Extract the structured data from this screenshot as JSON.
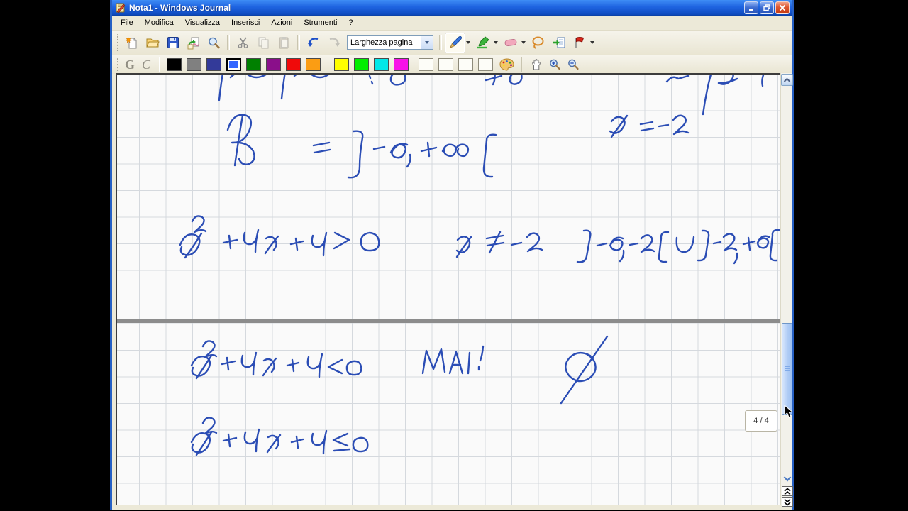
{
  "window": {
    "title": "Nota1 - Windows Journal",
    "titlebar_color": "#1e63e0",
    "border_color": "#2660c4"
  },
  "menu_bar": {
    "items": [
      {
        "label": "File",
        "name": "file"
      },
      {
        "label": "Modifica",
        "name": "modifica"
      },
      {
        "label": "Visualizza",
        "name": "visualizza"
      },
      {
        "label": "Inserisci",
        "name": "inserisci"
      },
      {
        "label": "Azioni",
        "name": "azioni"
      },
      {
        "label": "Strumenti",
        "name": "strumenti"
      },
      {
        "label": "?",
        "name": "help"
      }
    ]
  },
  "toolbar_main": {
    "page_width_value": "Larghezza pagina",
    "buttons": [
      "new-note",
      "open",
      "save",
      "import-picture",
      "search",
      "cut",
      "copy",
      "paste",
      "undo",
      "redo",
      "pen",
      "highlighter",
      "eraser",
      "lasso",
      "insert-note",
      "flag"
    ],
    "disabled_buttons": [
      "copy",
      "paste",
      "redo"
    ],
    "selected_tool": "pen"
  },
  "toolbar_format": {
    "bold_label": "G",
    "italic_label": "C",
    "selected_index": 3,
    "colors": [
      {
        "name": "black",
        "hex": "#000000"
      },
      {
        "name": "gray",
        "hex": "#808080"
      },
      {
        "name": "navy",
        "hex": "#333a99"
      },
      {
        "name": "blue",
        "hex": "#3366ff"
      },
      {
        "name": "green",
        "hex": "#008000"
      },
      {
        "name": "purple",
        "hex": "#8a0f8a"
      },
      {
        "name": "red",
        "hex": "#f00a0a"
      },
      {
        "name": "orange",
        "hex": "#fb9d13"
      },
      {
        "name": "yellow",
        "hex": "#ffff00"
      },
      {
        "name": "lime",
        "hex": "#00ee00"
      },
      {
        "name": "cyan",
        "hex": "#00e8e8"
      },
      {
        "name": "magenta",
        "hex": "#f812e8"
      }
    ],
    "thickness_slots": 4
  },
  "icons": {
    "new-note": "page with orange star",
    "open": "open folder",
    "save": "blue floppy disk",
    "import-picture": "pages with green arrow",
    "search": "magnifier",
    "cut": "scissors",
    "copy": "two pages",
    "paste": "clipboard",
    "undo": "curved arrow left",
    "redo": "curved arrow right",
    "pen": "blue pen",
    "highlighter": "green marker",
    "eraser": "pink eraser",
    "lasso": "lasso loop",
    "insert-note": "page with green arrow",
    "flag": "red flag",
    "palette": "paint palette",
    "pan-hand": "open hand",
    "zoom-in": "magnifier plus",
    "zoom-out": "magnifier minus",
    "minimize": "underscore",
    "restore": "overlapping squares",
    "close": "x",
    "scroll-up": "chevron up",
    "scroll-down": "chevron down",
    "prev-page": "double chevron up",
    "next-page": "double chevron down"
  },
  "nav": {
    "page_indicator": "4 / 4"
  },
  "ink": {
    "color": "#2b4db5",
    "lines": [
      {
        "name": "top-clipped-line",
        "text": "(riga di scrittura tagliata in alto)",
        "strokes": [
          "M150,-8 Q146,16 144,36",
          "M160,4 Q172,-8 184,0 Q196,8 210,0",
          "M238,-10 Q234,14 232,34",
          "M250,2 Q262,-8 274,0 Q286,8 298,0",
          "M356,2 L357,5",
          "M359,10 L360,13",
          "M395,-4 Q385,0 386,8 Q388,16 398,14 Q408,12 406,2 Q404,-4 396,-4",
          "M520,8 L542,2",
          "M532,-6 Q534,6 530,14",
          "M560,-2 Q552,2 554,10 Q558,16 566,12 Q572,8 570,0",
          "M775,10 Q783,0 791,6 L805,2",
          "M838,-4 Q830,26 826,56",
          "M846,-2 Q856,-10 866,-4 Q872,2 864,10 Q856,16 848,12 Q862,12 874,6",
          "M912,-2 Q908,8 910,16"
        ]
      },
      {
        "name": "x-equals-minus-2",
        "text": "x = -2",
        "strokes": [
          "M697,66 Q705,56 713,62 Q719,68 711,78 Q703,86 695,80",
          "M719,58 Q707,74 697,88",
          "M738,70 L755,67",
          "M739,79 L756,76",
          "M764,73 L777,71",
          "M784,64 Q792,54 800,60 Q805,66 796,74 L785,84 Q796,77 805,82"
        ]
      },
      {
        "name": "reals-interval",
        "text": "R = ]-oo, +oo[",
        "strokes": [
          "M166,128 Q171,92 177,58",
          "M156,78 Q163,54 180,57 Q194,61 186,80 Q178,97 162,96 Q184,94 192,108 Q197,121 186,126 Q176,129 172,119",
          "M277,100 L299,96",
          "M278,110 L300,106",
          "M333,80 Q348,78 346,89 Q342,112 342,130 Q342,147 326,145",
          "M362,105 L377,102",
          "M386,110 Q391,97 401,99 Q410,101 405,111 Q400,120 391,116 Q384,111 391,104 Q399,94 409,99",
          "M413,113 Q415,122 409,130",
          "M429,108 L450,103",
          "M438,96 L440,115",
          "M459,108 Q463,97 472,99 Q480,101 477,109 Q474,117 466,114 Q459,111 462,104 M477,106 Q481,97 490,99 Q497,102 494,110 Q491,117 484,114 Q478,111 481,105",
          "M534,85 Q521,83 521,93 L517,132 Q516,145 529,144"
        ]
      },
      {
        "name": "inequality-gt",
        "text": "x^2 + 4x + 4 > 0",
        "strokes": [
          "M89,240 Q96,222 110,226 Q121,231 113,245 Q105,258 93,253 Q88,250 91,243",
          "M119,224 Q107,243 96,258",
          "M106,207 Q111,196 120,201 Q126,206 118,214 L109,222 Q120,217 125,221",
          "M150,237 L169,233",
          "M158,227 L160,245",
          "M180,223 Q176,237 185,239 Q193,240 197,230",
          "M199,219 Q195,235 195,250",
          "M210,231 Q218,226 223,233 Q227,240 221,247",
          "M227,228 Q217,240 209,252",
          "M245,239 L262,235",
          "M252,231 L254,247",
          "M276,227 Q272,241 281,243 Q289,244 293,234",
          "M295,223 Q291,240 291,255",
          "M307,223 L327,233 L306,245",
          "M356,223 Q343,225 344,237 Q345,249 358,248 Q371,247 369,234 Q367,224 356,223"
        ]
      },
      {
        "name": "x-not-equal",
        "text": "x =/= -2",
        "strokes": [
          "M480,233 Q488,225 495,231 Q500,238 493,247 Q486,254 479,248",
          "M499,229 Q488,243 479,257",
          "M521,231 L544,227",
          "M522,241 L545,237",
          "M540,222 L525,251",
          "M556,240 L570,237",
          "M578,229 Q586,220 593,226 Q598,232 590,240 L579,249 Q590,242 599,247"
        ]
      },
      {
        "name": "union-intervals",
        "text": "]-oo,-2[ U ]-2,+oo[",
        "strokes": [
          "M658,220 Q669,218 667,228 L662,256 Q660,266 649,264",
          "M677,241 L690,238",
          "M695,241 Q700,231 708,233 Q715,235 711,243 Q707,250 699,246 Q693,242 698,235 Q704,227 713,231",
          "M714,248 Q715,257 709,263",
          "M723,240 L734,238",
          "M739,231 Q747,223 753,229 Q757,234 749,242 L739,250 Q749,244 757,249",
          "M777,222 Q766,221 767,231 L764,256 Q763,265 774,264",
          "M789,230 Q787,250 799,250 Q811,250 813,229",
          "M825,220 Q835,219 834,228 L830,254 Q829,263 819,262",
          "M841,238 L851,236",
          "M855,229 Q863,221 869,227 Q873,232 865,240 L856,248 Q865,242 873,247",
          "M874,252 Q875,260 870,266",
          "M883,239 L899,235",
          "M890,230 L892,247",
          "M903,237 Q907,229 914,231 Q920,233 917,240 Q913,247 906,243 Q901,239 905,233 Q911,225 919,229",
          "M933,219 Q923,218 924,227 L921,254 Q920,263 930,262"
        ]
      },
      {
        "name": "inequality-lt",
        "text": "x^2 + 4x + 4 < 0",
        "strokes": [
          "M105,410 Q112,394 125,398 Q135,403 128,416 Q120,428 109,423 Q104,420 107,413",
          "M133,396 Q122,413 112,428",
          "M121,383 Q126,372 135,377 Q141,382 133,390 L124,398 Q135,393 140,397",
          "M148,408 L166,404",
          "M155,399 L157,416",
          "M177,396 Q173,410 182,412 Q190,413 194,403",
          "M196,392 Q192,408 192,423",
          "M207,403 Q215,398 220,405 Q224,412 218,419",
          "M224,400 Q214,412 206,424",
          "M240,410 L256,406",
          "M247,402 L249,418",
          "M270,398 Q266,412 275,414 Q283,415 287,405",
          "M289,394 Q285,411 285,426",
          "M317,402 L298,412 L317,421",
          "M333,404 Q323,406 324,415 Q325,424 336,423 Q346,422 344,411 Q342,403 333,404"
        ]
      },
      {
        "name": "mai-annotation",
        "text": "MAI !",
        "strokes": [
          "M431,421 L436,389 L446,415 L457,387 L462,419",
          "M469,421 L478,391 L487,421",
          "M473,409 L484,409",
          "M497,392 L495,421",
          "M516,383 Q515,395 512,403",
          "M510,412 L510,416"
        ]
      },
      {
        "name": "empty-set",
        "text": "(insieme vuoto)",
        "strokes": [
          "M667,396 Q650,387 638,399 Q627,411 637,424 Q649,437 664,429 Q677,421 674,408 Q672,399 663,395",
          "M691,369 L626,463"
        ]
      },
      {
        "name": "inequality-le",
        "text": "x^2 + 4x + 4 <= 0",
        "strokes": [
          "M105,518 Q112,502 125,506 Q135,511 128,524 Q120,536 109,531 Q104,528 107,521",
          "M133,504 Q122,521 112,536",
          "M121,491 Q126,480 135,485 Q141,490 133,498 L124,506 Q135,501 140,505",
          "M150,516 L168,512",
          "M157,507 L159,524",
          "M181,504 Q177,518 186,520 Q194,521 198,511",
          "M200,500 Q196,516 196,531",
          "M213,511 Q221,506 226,513 Q230,520 224,527",
          "M230,508 Q220,520 212,532",
          "M246,518 L262,514",
          "M253,510 L255,526",
          "M276,506 Q272,520 281,522 Q289,523 293,513",
          "M295,502 Q291,519 291,534",
          "M325,506 L305,515 L325,523",
          "M306,530 L328,528",
          "M342,512 Q332,514 333,523 Q334,532 345,531 Q355,530 353,519 Q351,511 342,512"
        ]
      }
    ]
  }
}
